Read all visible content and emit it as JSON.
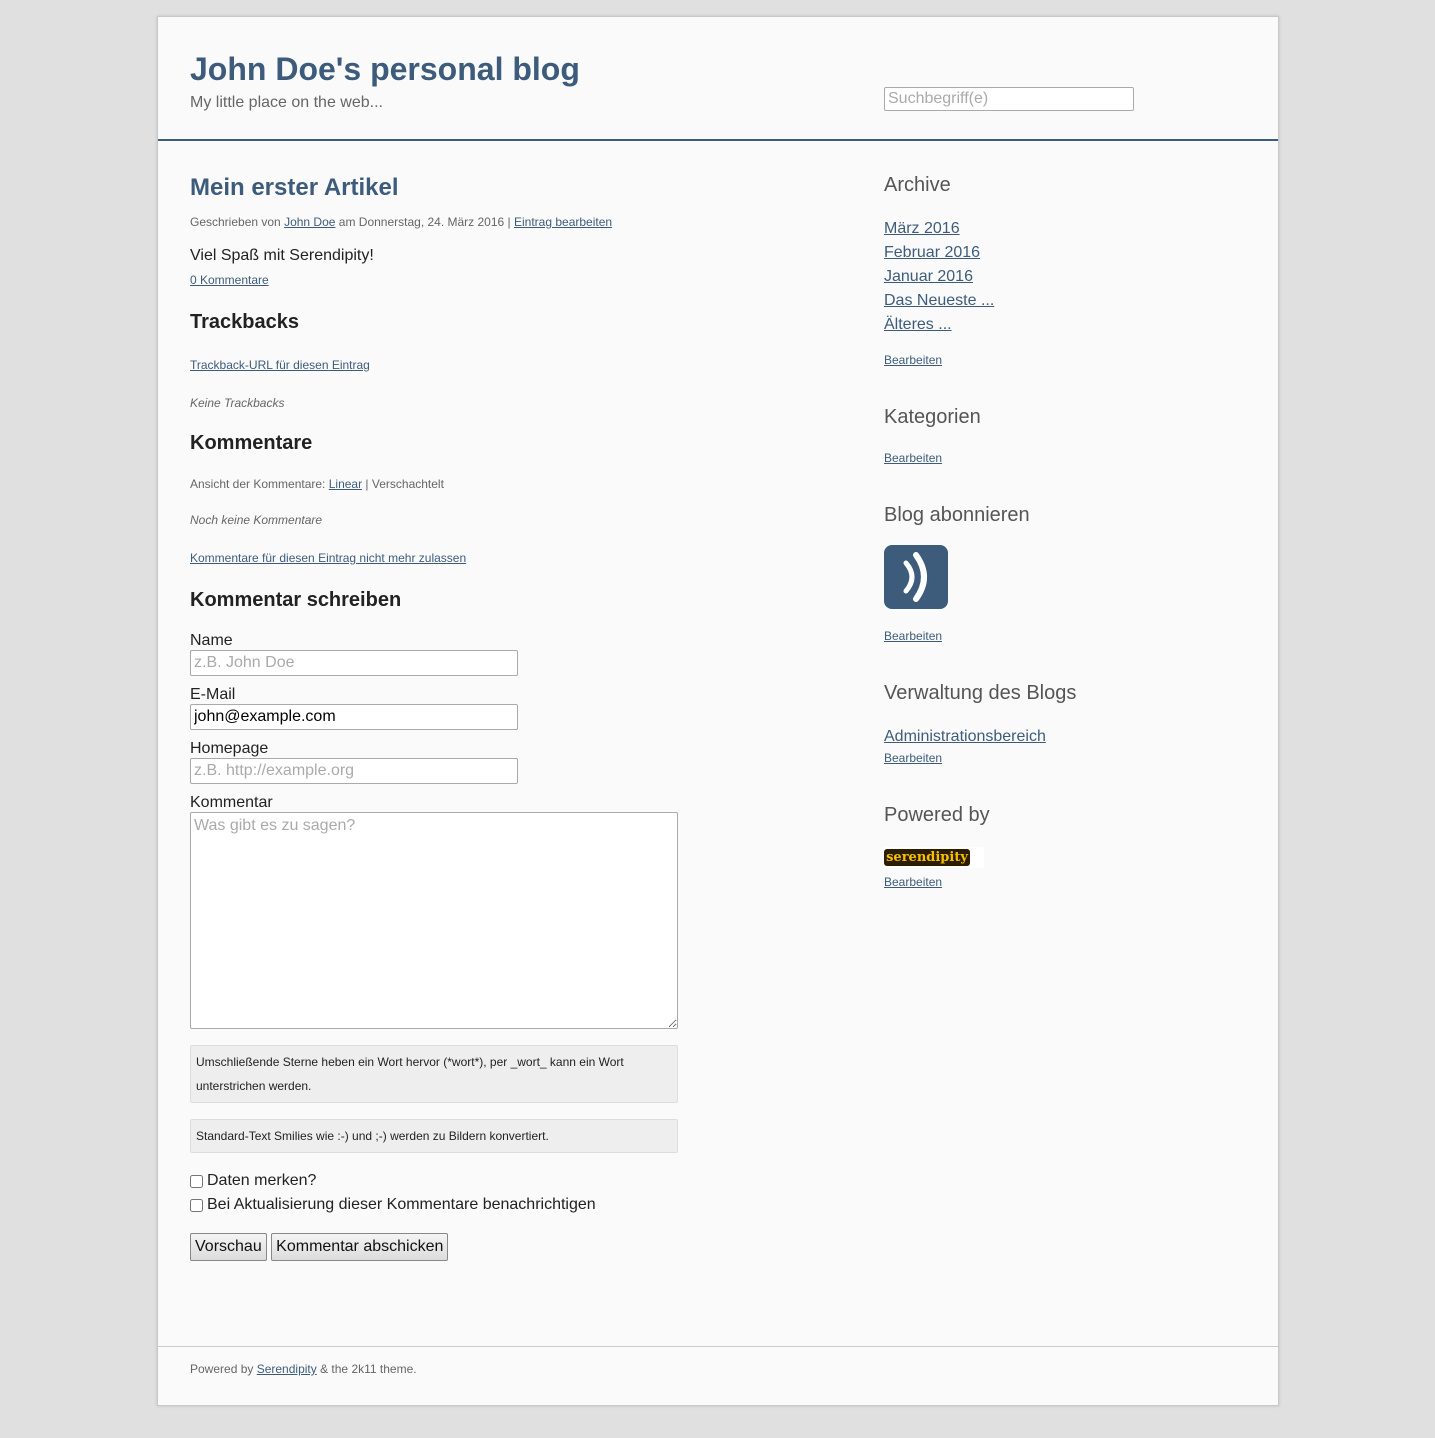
{
  "header": {
    "title": "John Doe's personal blog",
    "tagline": "My little place on the web...",
    "search_placeholder": "Suchbegriff(e)"
  },
  "entry": {
    "title": "Mein erster Artikel",
    "meta_prefix": "Geschrieben von ",
    "author": "John Doe",
    "meta_date": " am Donnerstag, 24. März 2016 | ",
    "edit_link": "Eintrag bearbeiten",
    "body": "Viel Spaß mit Serendipity!",
    "comments_link": "0 Kommentare"
  },
  "trackbacks": {
    "heading": "Trackbacks",
    "url_link": "Trackback-URL für diesen Eintrag",
    "none": "Keine Trackbacks"
  },
  "comments": {
    "heading": "Kommentare",
    "view_prefix": "Ansicht der Kommentare: ",
    "view_linear": "Linear",
    "view_sep": " | ",
    "view_nested": "Verschachtelt",
    "none": "Noch keine Kommentare",
    "disallow_link": "Kommentare für diesen Eintrag nicht mehr zulassen"
  },
  "form": {
    "heading": "Kommentar schreiben",
    "name_label": "Name",
    "name_placeholder": "z.B. John Doe",
    "email_label": "E-Mail",
    "email_value": "john@example.com",
    "homepage_label": "Homepage",
    "homepage_placeholder": "z.B. http://example.org",
    "comment_label": "Kommentar",
    "comment_placeholder": "Was gibt es zu sagen?",
    "hint_markup": "Umschließende Sterne heben ein Wort hervor (*wort*), per _wort_ kann ein Wort unterstrichen werden.",
    "hint_smilies": "Standard-Text Smilies wie :-) und ;-) werden zu Bildern konvertiert.",
    "remember_label": "Daten merken?",
    "notify_label": "Bei Aktualisierung dieser Kommentare benachrichtigen",
    "preview_button": "Vorschau",
    "submit_button": "Kommentar abschicken"
  },
  "sidebar": {
    "archive": {
      "heading": "Archive",
      "items": [
        "März 2016",
        "Februar 2016",
        "Januar 2016",
        "Das Neueste ...",
        "Älteres ..."
      ],
      "edit": "Bearbeiten"
    },
    "categories": {
      "heading": "Kategorien",
      "edit": "Bearbeiten"
    },
    "subscribe": {
      "heading": "Blog abonnieren",
      "icon": "feed-icon",
      "edit": "Bearbeiten"
    },
    "admin": {
      "heading": "Verwaltung des Blogs",
      "link": "Administrationsbereich",
      "edit": "Bearbeiten"
    },
    "powered": {
      "heading": "Powered by",
      "logo_text": "serendipity",
      "edit": "Bearbeiten"
    }
  },
  "footer": {
    "prefix": "Powered by ",
    "link": "Serendipity",
    "suffix": " & the 2k11 theme."
  },
  "colors": {
    "accent": "#3d5c7c",
    "background": "#e0e0e0",
    "page": "#fafafa"
  }
}
